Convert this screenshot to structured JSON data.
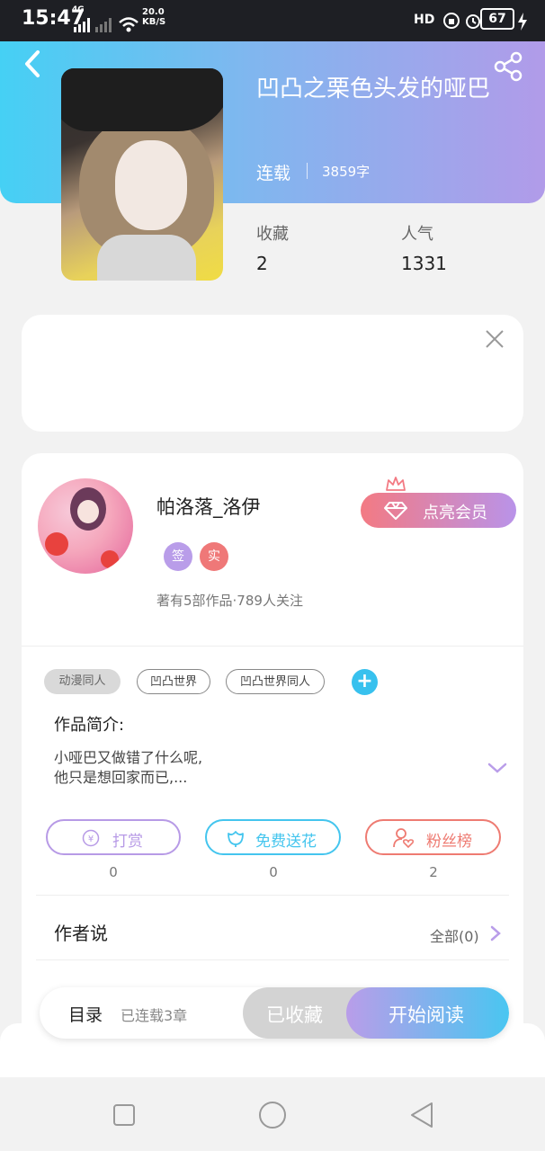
{
  "status_bar": {
    "time": "15:47",
    "net_type": "4G",
    "net_speed_value": "20.0",
    "net_speed_unit": "KB/S",
    "hd_label": "HD",
    "battery": "67"
  },
  "book": {
    "title": "凹凸之栗色头发的哑巴",
    "status": "连载",
    "word_count": "3859字",
    "stats": [
      {
        "label": "收藏",
        "value": "2"
      },
      {
        "label": "人气",
        "value": "1331"
      }
    ]
  },
  "author": {
    "name": "帕洛落_洛伊",
    "badges": [
      "签",
      "实"
    ],
    "info": "著有5部作品·789人关注",
    "vip_button": "点亮会员"
  },
  "tags": [
    "动漫同人",
    "凹凸世界",
    "凹凸世界同人"
  ],
  "intro": {
    "heading": "作品简介:",
    "line1": "小哑巴又做错了什么呢,",
    "line2": "他只是想回家而已,..."
  },
  "actions": [
    {
      "label": "打赏",
      "count": "0",
      "color": "#b79ae6"
    },
    {
      "label": "免费送花",
      "count": "0",
      "color": "#44c5ee"
    },
    {
      "label": "粉丝榜",
      "count": "2",
      "color": "#ee7b72"
    }
  ],
  "author_says": {
    "heading": "作者说",
    "all_label": "全部(0)"
  },
  "bottom_bar": {
    "toc": "目录",
    "chapters": "已连载3章",
    "favorited": "已收藏",
    "read": "开始阅读"
  },
  "colors": {
    "header_start": "#45d0f4",
    "header_end": "#b19be9",
    "accent_purple": "#b99de9",
    "accent_cyan": "#49c6f1"
  }
}
